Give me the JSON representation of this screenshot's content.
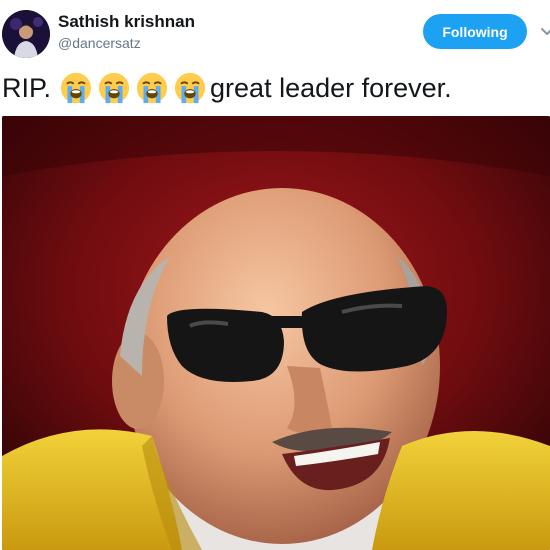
{
  "tweet": {
    "author": {
      "display_name": "Sathish krishnan",
      "handle": "@dancersatz",
      "avatar_icon": "user-avatar-photo"
    },
    "follow_button_label": "Following",
    "text_before_emoji": "RIP.",
    "emoji": [
      "loudly-crying-face",
      "loudly-crying-face",
      "loudly-crying-face",
      "loudly-crying-face"
    ],
    "text_after_emoji": "great leader forever.",
    "media": {
      "type": "photo",
      "subject": "smiling man in dark glasses and yellow shawl"
    },
    "menu_icon": "chevron-down-icon"
  },
  "colors": {
    "accent": "#1da1f2",
    "name_text": "#14171a",
    "handle_text": "#657786",
    "photo_background": "#7a0d10",
    "shawl": "#e8c21a"
  }
}
